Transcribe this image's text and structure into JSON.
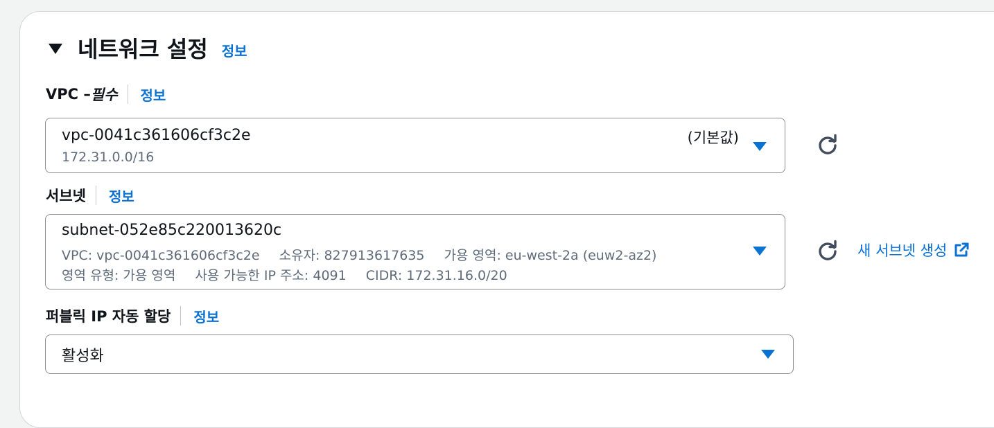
{
  "section": {
    "title": "네트워크 설정",
    "info": "정보"
  },
  "vpc": {
    "label": "VPC – ",
    "label_required": "필수",
    "info": "정보",
    "value": "vpc-0041c361606cf3c2e",
    "cidr": "172.31.0.0/16",
    "tag": "(기본값)"
  },
  "subnet": {
    "label": "서브넷",
    "info": "정보",
    "value": "subnet-052e85c220013620c",
    "vpc": "VPC: vpc-0041c361606cf3c2e",
    "owner": "소유자: 827913617635",
    "az": "가용 영역: eu-west-2a (euw2-az2)",
    "zone_type": "영역 유형: 가용 영역",
    "available_ips": "사용 가능한 IP 주소: 4091",
    "cidr": "CIDR: 172.31.16.0/20",
    "create_link": "새 서브넷 생성"
  },
  "public_ip": {
    "label": "퍼블릭 IP 자동 할당",
    "info": "정보",
    "value": "활성화"
  },
  "colors": {
    "link": "#0972d3",
    "text": "#0f141a",
    "secondary_text": "#5f6b7a",
    "border": "#8c8c94"
  }
}
